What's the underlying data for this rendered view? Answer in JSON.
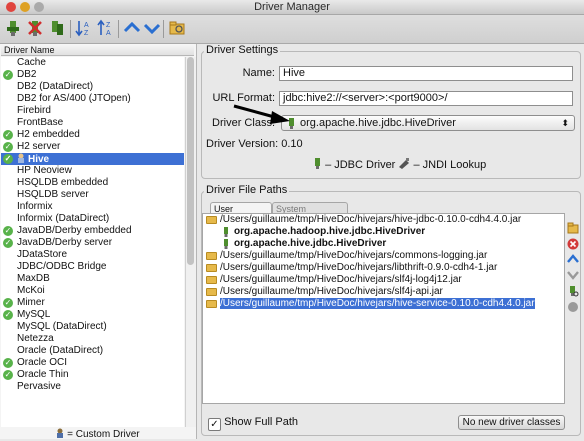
{
  "window": {
    "title": "Driver Manager"
  },
  "colors": {
    "selection": "#3d70d4",
    "check": "#58b24a",
    "folder": "#e6b94a"
  },
  "toolbar": {
    "icons": [
      "new-driver-icon",
      "delete-driver-icon",
      "copy-driver-icon",
      "sort-ascending-icon",
      "sort-descending-icon",
      "move-up-icon",
      "move-down-icon",
      "folder-icon"
    ]
  },
  "driver_list": {
    "header": "Driver Name",
    "items": [
      {
        "label": "Cache",
        "ok": false
      },
      {
        "label": "DB2",
        "ok": true
      },
      {
        "label": "DB2 (DataDirect)",
        "ok": false
      },
      {
        "label": "DB2 for AS/400 (JTOpen)",
        "ok": false
      },
      {
        "label": "Firebird",
        "ok": false
      },
      {
        "label": "FrontBase",
        "ok": false
      },
      {
        "label": "H2 embedded",
        "ok": true
      },
      {
        "label": "H2 server",
        "ok": true
      },
      {
        "label": "Hive",
        "ok": true,
        "selected": true
      },
      {
        "label": "HP Neoview",
        "ok": false
      },
      {
        "label": "HSQLDB embedded",
        "ok": false
      },
      {
        "label": "HSQLDB server",
        "ok": false
      },
      {
        "label": "Informix",
        "ok": false
      },
      {
        "label": "Informix (DataDirect)",
        "ok": false
      },
      {
        "label": "JavaDB/Derby embedded",
        "ok": true
      },
      {
        "label": "JavaDB/Derby server",
        "ok": true
      },
      {
        "label": "JDataStore",
        "ok": false
      },
      {
        "label": "JDBC/ODBC Bridge",
        "ok": false
      },
      {
        "label": "MaxDB",
        "ok": false
      },
      {
        "label": "McKoi",
        "ok": false
      },
      {
        "label": "Mimer",
        "ok": true
      },
      {
        "label": "MySQL",
        "ok": true
      },
      {
        "label": "MySQL (DataDirect)",
        "ok": false
      },
      {
        "label": "Netezza",
        "ok": false
      },
      {
        "label": "Oracle (DataDirect)",
        "ok": false
      },
      {
        "label": "Oracle OCI",
        "ok": true
      },
      {
        "label": "Oracle Thin",
        "ok": true
      },
      {
        "label": "Pervasive",
        "ok": false
      }
    ],
    "footer": "= Custom Driver"
  },
  "settings": {
    "title": "Driver Settings",
    "name_label": "Name:",
    "name_value": "Hive",
    "url_label": "URL Format:",
    "url_value": "jdbc:hive2://<server>:<port9000>/",
    "class_label": "Driver Class:",
    "class_value": "org.apache.hive.jdbc.HiveDriver",
    "version_label": "Driver Version:",
    "version_value": "0.10",
    "legend_jdbc": "– JDBC Driver",
    "legend_jndi": "– JNDI Lookup"
  },
  "file_paths": {
    "title": "Driver File Paths",
    "tabs": [
      "User Specified",
      "System Classpath"
    ],
    "items": [
      {
        "text": "/Users/guillaume/tmp/HiveDoc/hivejars/hive-jdbc-0.10.0-cdh4.4.0.jar",
        "type": "folder"
      },
      {
        "text": "org.apache.hadoop.hive.jdbc.HiveDriver",
        "type": "class"
      },
      {
        "text": "org.apache.hive.jdbc.HiveDriver",
        "type": "class"
      },
      {
        "text": "/Users/guillaume/tmp/HiveDoc/hivejars/commons-logging.jar",
        "type": "folder"
      },
      {
        "text": "/Users/guillaume/tmp/HiveDoc/hivejars/libthrift-0.9.0-cdh4-1.jar",
        "type": "folder"
      },
      {
        "text": "/Users/guillaume/tmp/HiveDoc/hivejars/slf4j-log4j12.jar",
        "type": "folder"
      },
      {
        "text": "/Users/guillaume/tmp/HiveDoc/hivejars/slf4j-api.jar",
        "type": "folder"
      },
      {
        "text": "/Users/guillaume/tmp/HiveDoc/hivejars/hive-service-0.10.0-cdh4.4.0.jar",
        "type": "folder",
        "selected": true
      }
    ],
    "show_full_path": "Show Full Path",
    "no_new_classes": "No new driver classes"
  }
}
